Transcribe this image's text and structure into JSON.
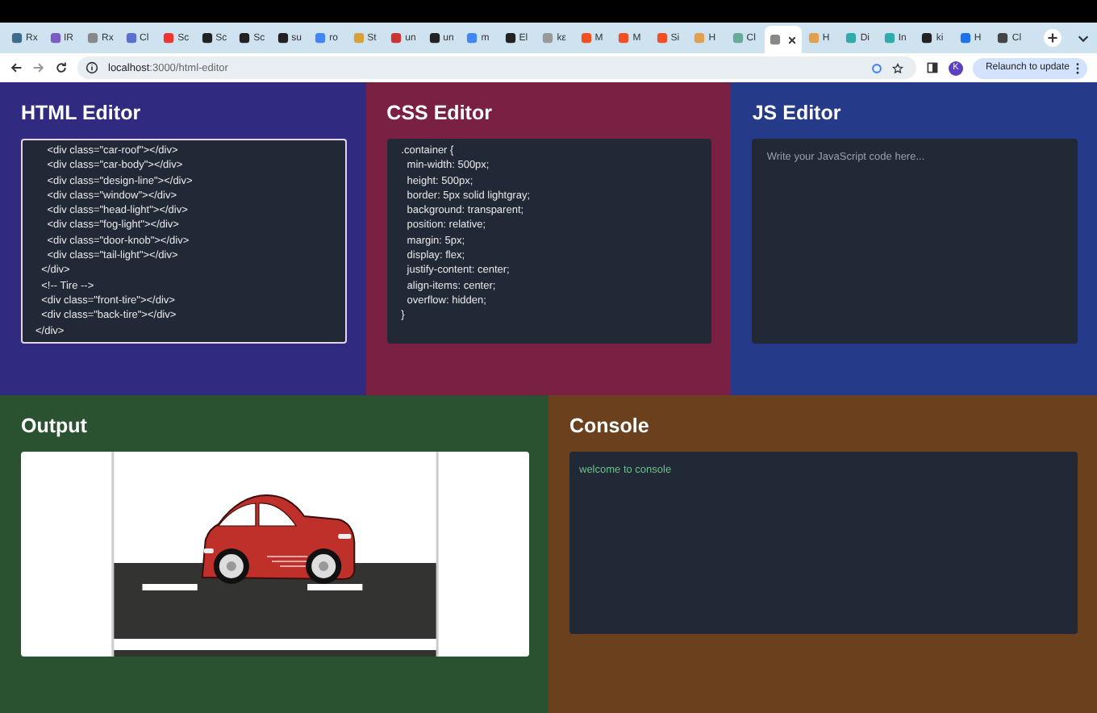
{
  "browser": {
    "tabs": [
      {
        "label": "Rx",
        "selected": false
      },
      {
        "label": "IR",
        "selected": false
      },
      {
        "label": "Rx",
        "selected": false
      },
      {
        "label": "Cl",
        "selected": false
      },
      {
        "label": "Sc",
        "selected": false
      },
      {
        "label": "Sc",
        "selected": false
      },
      {
        "label": "Sc",
        "selected": false
      },
      {
        "label": "su",
        "selected": false
      },
      {
        "label": "ro",
        "selected": false
      },
      {
        "label": "St",
        "selected": false
      },
      {
        "label": "un",
        "selected": false
      },
      {
        "label": "un",
        "selected": false
      },
      {
        "label": "m",
        "selected": false
      },
      {
        "label": "El",
        "selected": false
      },
      {
        "label": "kε",
        "selected": false
      },
      {
        "label": "M",
        "selected": false
      },
      {
        "label": "M",
        "selected": false
      },
      {
        "label": "Si",
        "selected": false
      },
      {
        "label": "H",
        "selected": false
      },
      {
        "label": "Cl",
        "selected": false
      },
      {
        "selected": true
      },
      {
        "label": "H",
        "selected": false
      },
      {
        "label": "Di",
        "selected": false
      },
      {
        "label": "In",
        "selected": false
      },
      {
        "label": "ki",
        "selected": false
      },
      {
        "label": "H",
        "selected": false
      },
      {
        "label": "Cl",
        "selected": false
      }
    ],
    "address": {
      "host": "localhost",
      "path": ":3000/html-editor"
    },
    "avatar": "K",
    "relaunch_button": "Relaunch to update"
  },
  "editors": [
    {
      "title": "HTML Editor",
      "focused": true,
      "lines": [
        "    <div class=\"car-roof\"></div>",
        "    <div class=\"car-body\"></div>",
        "    <div class=\"design-line\"></div>",
        "    <div class=\"window\"></div>",
        "    <div class=\"head-light\"></div>",
        "    <div class=\"fog-light\"></div>",
        "    <div class=\"door-knob\"></div>",
        "    <div class=\"tail-light\"></div>",
        "  </div>",
        "  <!-- Tire -->",
        "  <div class=\"front-tire\"></div>",
        "  <div class=\"back-tire\"></div>",
        "</div>"
      ]
    },
    {
      "title": "CSS Editor",
      "focused": false,
      "lines": [
        ".container {",
        "  min-width: 500px;",
        "  height: 500px;",
        "  border: 5px solid lightgray;",
        "  background: transparent;",
        "  position: relative;",
        "  margin: 5px;",
        "  display: flex;",
        "  justify-content: center;",
        "  align-items: center;",
        "  overflow: hidden;",
        "}"
      ]
    },
    {
      "title": "JS Editor",
      "focused": false,
      "placeholder": "Write your JavaScript code here..."
    }
  ],
  "output": {
    "title": "Output"
  },
  "console": {
    "title": "Console",
    "lines": [
      "welcome to console"
    ]
  }
}
